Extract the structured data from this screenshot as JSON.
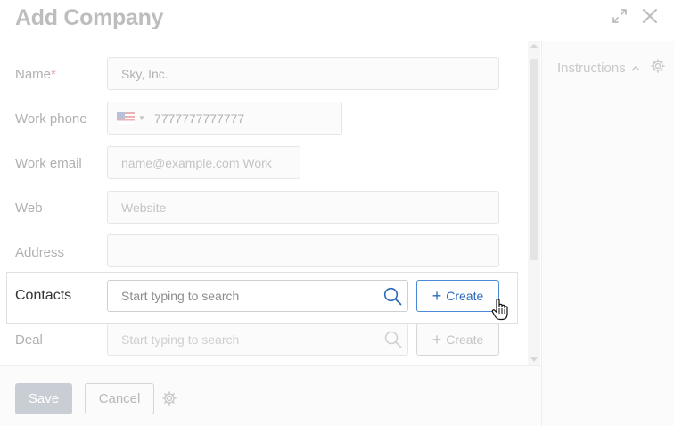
{
  "dialog": {
    "title": "Add Company"
  },
  "form": {
    "name": {
      "label": "Name",
      "required_mark": "*",
      "value": "Sky, Inc."
    },
    "work_phone": {
      "label": "Work phone",
      "value": "7777777777777"
    },
    "work_email": {
      "label": "Work email",
      "placeholder": "name@example.com Work"
    },
    "web": {
      "label": "Web",
      "placeholder": "Website"
    },
    "address": {
      "label": "Address",
      "value": ""
    },
    "contacts": {
      "label": "Contacts",
      "placeholder": "Start typing to search",
      "create_label": "Create",
      "create_plus": "+"
    },
    "deal": {
      "label": "Deal",
      "placeholder": "Start typing to search",
      "create_label": "Create",
      "create_plus": "+"
    }
  },
  "side_panel": {
    "instructions_label": "Instructions"
  },
  "footer": {
    "save_label": "Save",
    "cancel_label": "Cancel"
  },
  "icons": {
    "expand": "expand-icon",
    "close": "close-icon",
    "search": "search-icon",
    "gear": "gear-icon",
    "chevron_up": "chevron-up-icon",
    "flag": "us-flag-icon",
    "cursor": "hand-cursor-icon"
  },
  "colors": {
    "accent": "#2b69b8",
    "accent_border": "#4a8ad6",
    "required": "#e8a6a6",
    "save_disabled": "#c9cdd4"
  }
}
